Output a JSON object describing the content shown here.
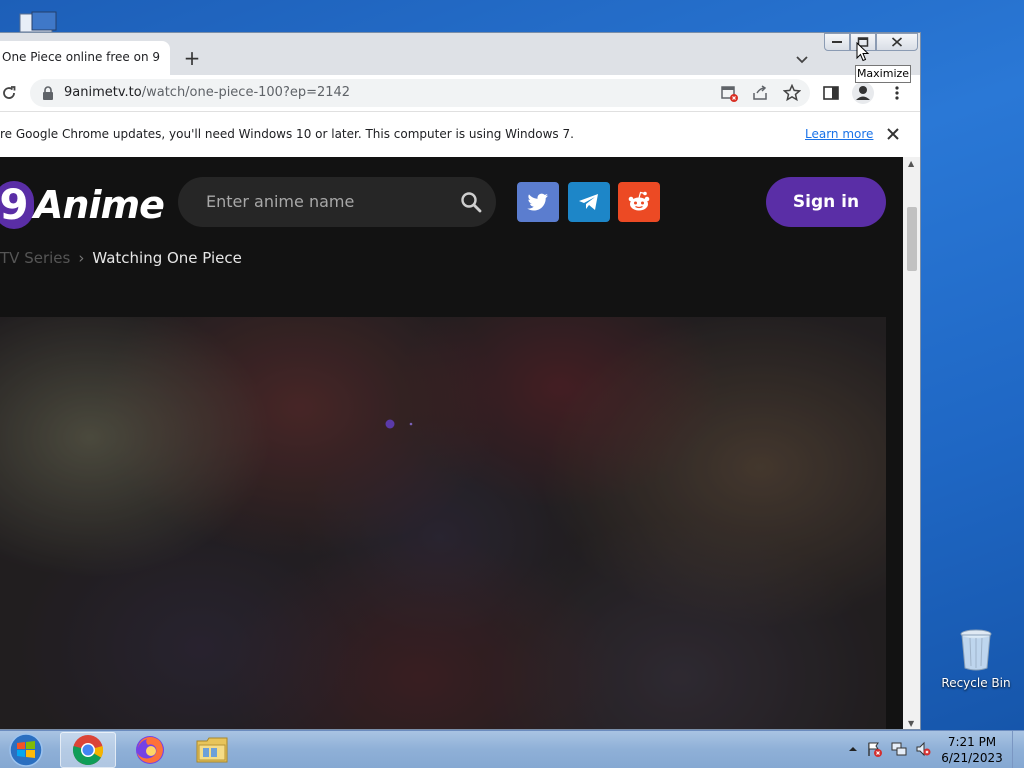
{
  "desktop": {
    "recycle_bin_label": "Recycle Bin"
  },
  "browser": {
    "tab_title": "One Piece online free on 9",
    "new_tab_symbol": "+",
    "tooltip": "Maximize",
    "url_host": "9animetv.to",
    "url_path": "/watch/one-piece-100?ep=2142",
    "infobar_message": "re Google Chrome updates, you'll need Windows 10 or later. This computer is using Windows 7.",
    "infobar_link": "Learn more",
    "infobar_close": "✕"
  },
  "site": {
    "logo_digit": "9",
    "logo_word": "Anime",
    "search_placeholder": "Enter anime name",
    "signin_label": "Sign in",
    "breadcrumb": {
      "parent": "TV Series",
      "separator": "›",
      "current": "Watching One Piece"
    },
    "colors": {
      "accent": "#5a2ea6",
      "twitter": "#5b7dcf",
      "telegram": "#1d86c8",
      "reddit": "#ec4a24"
    }
  },
  "taskbar": {
    "time": "7:21 PM",
    "date": "6/21/2023",
    "apps": [
      "chrome-icon",
      "firefox-icon",
      "file-explorer-icon"
    ]
  }
}
